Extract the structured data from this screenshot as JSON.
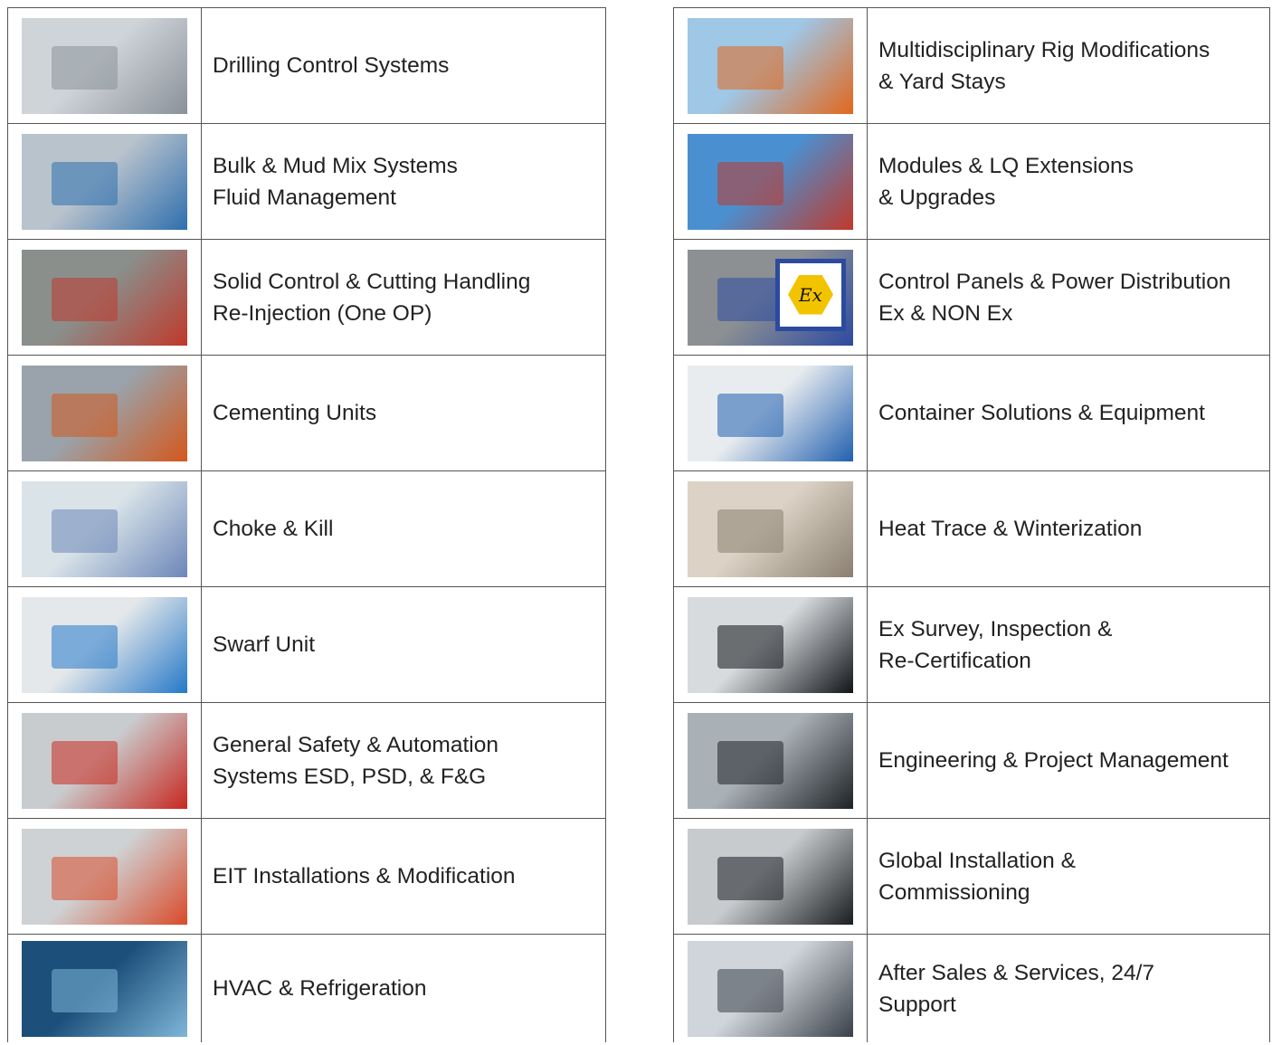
{
  "left_items": [
    {
      "label": "Drilling Control Systems",
      "image": "drilling-control-chair-photo",
      "bg": [
        "#cfd4d9",
        "#8a9199"
      ]
    },
    {
      "label": "Bulk & Mud Mix Systems\nFluid Management",
      "image": "mud-mix-equipment-photo",
      "bg": [
        "#b9c3cc",
        "#2e6fae"
      ]
    },
    {
      "label": "Solid Control & Cutting Handling\nRe-Injection (One OP)",
      "image": "solid-control-3d-model",
      "bg": [
        "#8a8f8c",
        "#c0392b"
      ]
    },
    {
      "label": "Cementing Units",
      "image": "cementing-units-3d-model",
      "bg": [
        "#9aa3ab",
        "#d4571b"
      ]
    },
    {
      "label": "Choke & Kill",
      "image": "choke-kill-screen-capture",
      "bg": [
        "#d9e3e8",
        "#6b86b8"
      ]
    },
    {
      "label": "Swarf Unit",
      "image": "swarf-unit-photo",
      "bg": [
        "#e5e8ea",
        "#2478c8"
      ]
    },
    {
      "label": "General Safety & Automation\nSystems ESD, PSD, & F&G",
      "image": "safety-automation-photo",
      "bg": [
        "#c9ccce",
        "#c8281f"
      ]
    },
    {
      "label": "EIT Installations & Modification",
      "image": "eit-installation-worker-photo",
      "bg": [
        "#cfd2d4",
        "#d94a2a"
      ]
    },
    {
      "label": "HVAC & Refrigeration",
      "image": "hvac-ducts-photo",
      "bg": [
        "#1c4f7a",
        "#7fb6d8"
      ]
    }
  ],
  "right_items": [
    {
      "label": "Multidisciplinary Rig Modifications\n& Yard Stays",
      "image": "rig-and-ship-photo",
      "bg": [
        "#9fc7e6",
        "#e2671c"
      ]
    },
    {
      "label": "Modules & LQ Extensions\n& Upgrades",
      "image": "module-lift-photo",
      "bg": [
        "#4a90d0",
        "#c0392b"
      ]
    },
    {
      "label": "Control Panels & Power Distribution\nEx & NON Ex",
      "image": "control-panel-ex-photo",
      "bg": [
        "#8d9092",
        "#2c4aa0"
      ],
      "badge": "Ex"
    },
    {
      "label": "Container Solutions & Equipment",
      "image": "container-solution-3d-model",
      "bg": [
        "#e9ecef",
        "#2160b0"
      ]
    },
    {
      "label": "Heat Trace & Winterization",
      "image": "heat-trace-pipe-photo",
      "bg": [
        "#dcd3c6",
        "#8a7f70"
      ]
    },
    {
      "label": "Ex Survey, Inspection &\nRe-Certification",
      "image": "ex-survey-technician-photo",
      "bg": [
        "#d8dbde",
        "#111418"
      ]
    },
    {
      "label": "Engineering & Project Management",
      "image": "engineering-workstation-photo",
      "bg": [
        "#a9b0b6",
        "#1e2226"
      ]
    },
    {
      "label": "Global Installation &\nCommissioning",
      "image": "installation-technician-photo",
      "bg": [
        "#c7cbce",
        "#1a1d20"
      ]
    },
    {
      "label": "After Sales & Services, 24/7\nSupport",
      "image": "after-sales-team-photo",
      "bg": [
        "#cfd5da",
        "#3a4048"
      ]
    }
  ]
}
